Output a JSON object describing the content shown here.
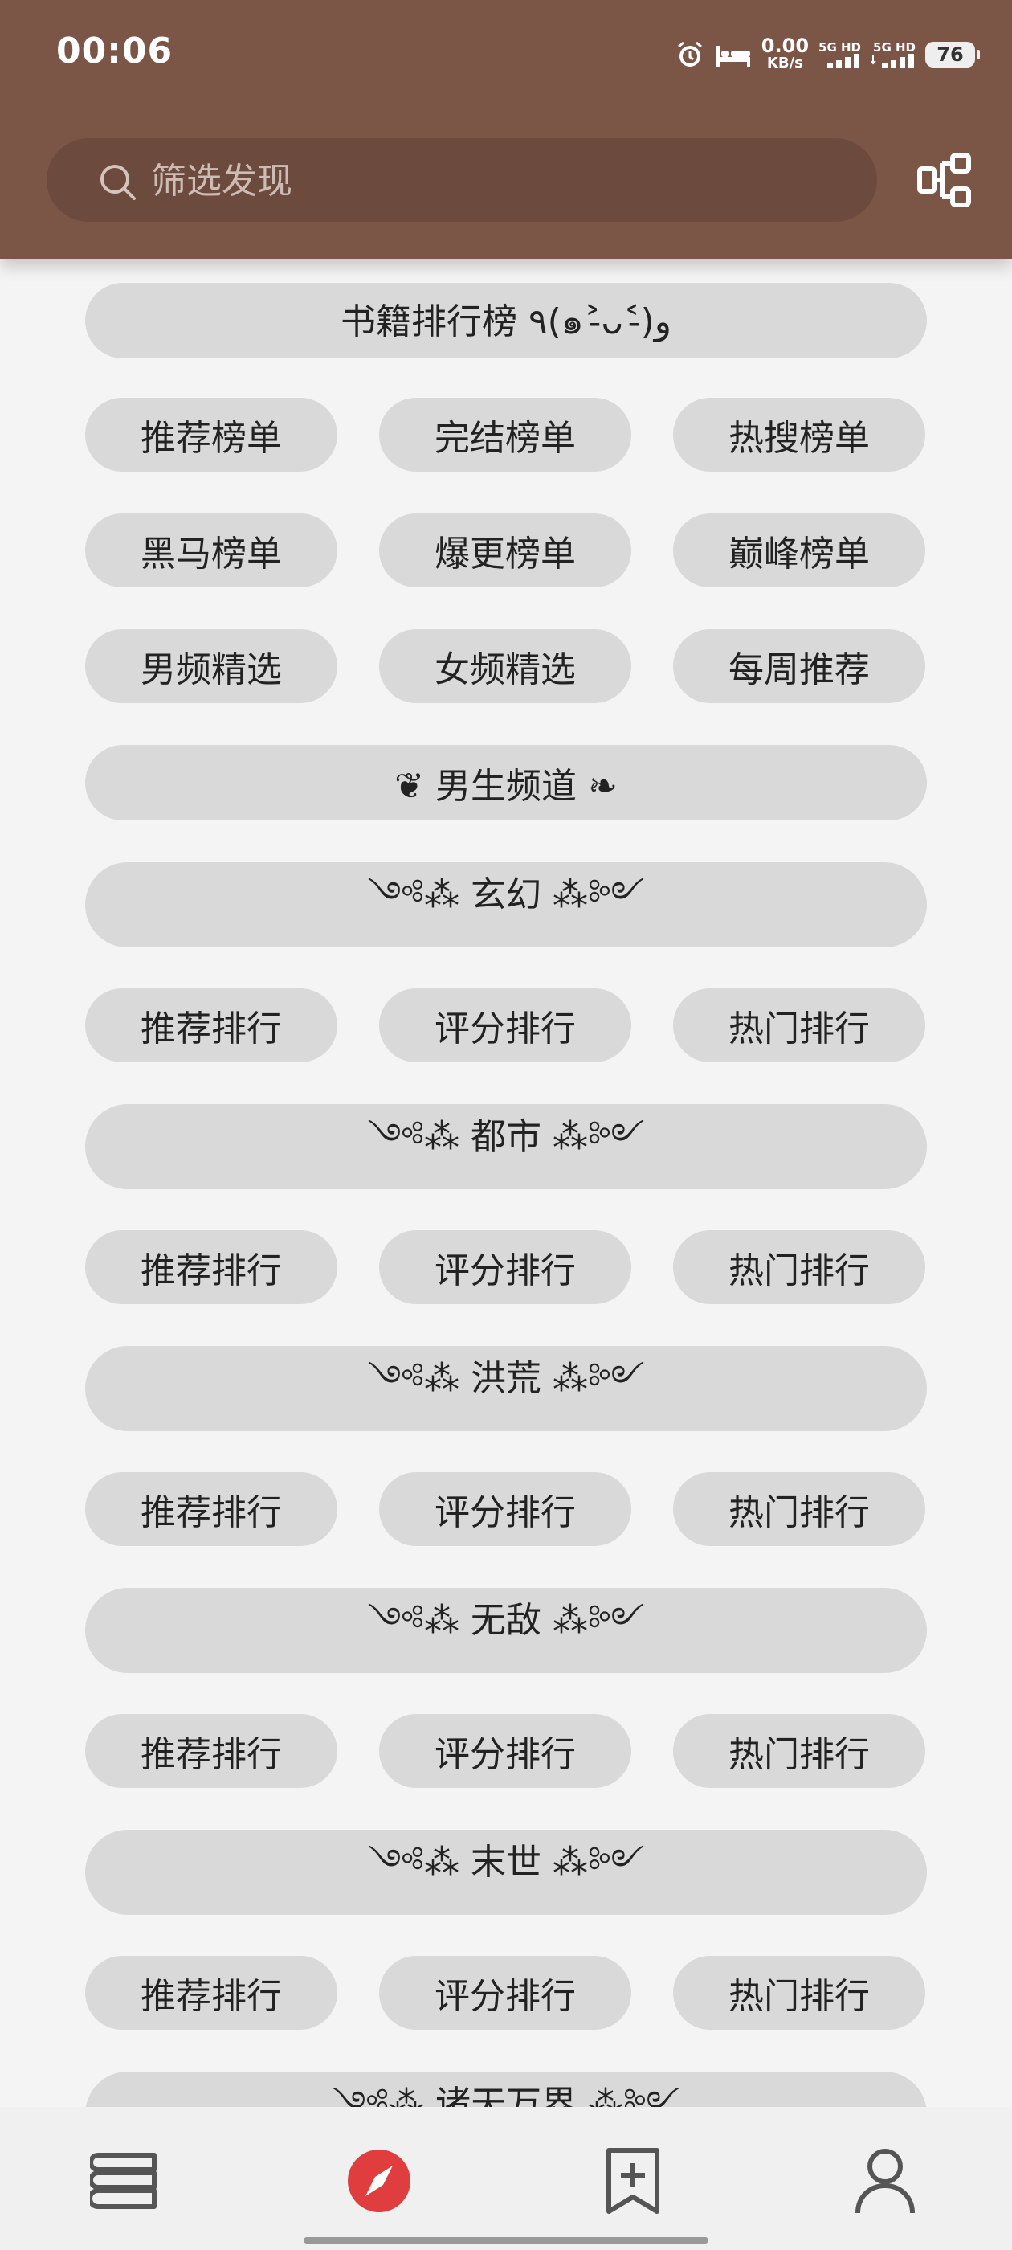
{
  "status_bar": {
    "time": "00:06",
    "net_speed": "0.00",
    "net_unit": "KB/s",
    "signal1": "5G HD",
    "signal2": "5G HD",
    "battery": "76"
  },
  "search": {
    "placeholder": "筛选发现"
  },
  "sections": [
    {
      "header": "书籍排行榜 ٩(๑˃̵ᴗ˂̵)و",
      "items": []
    },
    {
      "header": "",
      "items": [
        "推荐榜单",
        "完结榜单",
        "热搜榜单"
      ]
    },
    {
      "header": "",
      "items": [
        "黑马榜单",
        "爆更榜单",
        "巅峰榜单"
      ]
    },
    {
      "header": "",
      "items": [
        "男频精选",
        "女频精选",
        "每周推荐"
      ]
    },
    {
      "header": "❦ 男生频道 ❧",
      "items": []
    },
    {
      "header": "༺⁂ 玄幻 ⁂༻",
      "items": [
        "推荐排行",
        "评分排行",
        "热门排行"
      ]
    },
    {
      "header": "༺⁂ 都市 ⁂༻",
      "items": [
        "推荐排行",
        "评分排行",
        "热门排行"
      ]
    },
    {
      "header": "༺⁂ 洪荒 ⁂༻",
      "items": [
        "推荐排行",
        "评分排行",
        "热门排行"
      ]
    },
    {
      "header": "༺⁂ 无敌 ⁂༻",
      "items": [
        "推荐排行",
        "评分排行",
        "热门排行"
      ]
    },
    {
      "header": "༺⁂ 末世 ⁂༻",
      "items": [
        "推荐排行",
        "评分排行",
        "热门排行"
      ]
    },
    {
      "header": "༺⁂ 诸天万界 ⁂༻",
      "items": []
    }
  ],
  "bottom_nav": [
    {
      "name": "bookshelf",
      "icon": "books-icon"
    },
    {
      "name": "discover",
      "icon": "compass-icon",
      "active": true
    },
    {
      "name": "subscribe",
      "icon": "bookmark-add-icon"
    },
    {
      "name": "profile",
      "icon": "person-icon"
    }
  ],
  "colors": {
    "header_bg": "#7b5546",
    "pill_bg": "#d9d9d9",
    "accent": "#e03e3e"
  }
}
